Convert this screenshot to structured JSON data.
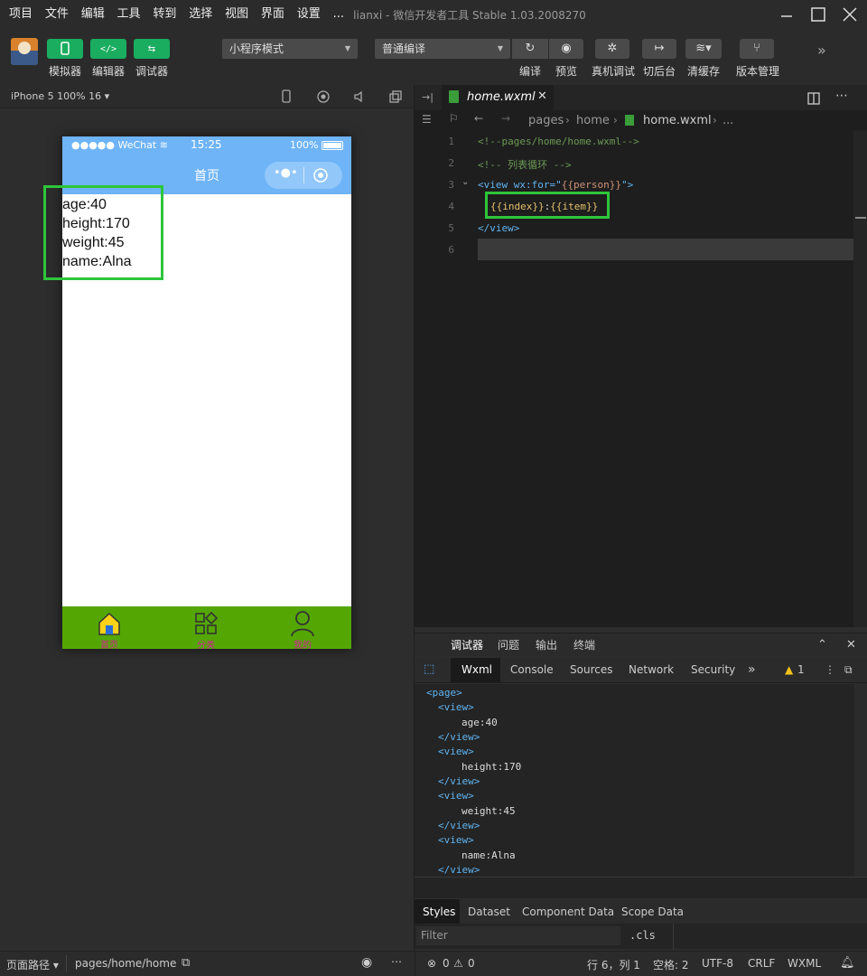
{
  "menu": [
    "项目",
    "文件",
    "编辑",
    "工具",
    "转到",
    "选择",
    "视图",
    "界面",
    "设置",
    "..."
  ],
  "window_title": "lianxi - 微信开发者工具 Stable 1.03.2008270",
  "toolbar": {
    "simulator": "模拟器",
    "editor": "编辑器",
    "debugger": "调试器",
    "mode": "小程序模式",
    "compile_mode": "普通编译",
    "compile": "编译",
    "preview": "预览",
    "remote_debug": "真机调试",
    "background": "切后台",
    "clear_cache": "清缓存",
    "version": "版本管理"
  },
  "simulator": {
    "device": "iPhone 5 100% 16",
    "carrier": "●●●●● WeChat",
    "time": "15:25",
    "battery": "100%",
    "nav_title": "首页",
    "items": [
      "age:40",
      "height:170",
      "weight:45",
      "name:Alna"
    ],
    "tabs": [
      "首页",
      "分类",
      "我的"
    ]
  },
  "editor": {
    "tab": "home.wxml",
    "breadcrumb": [
      "pages",
      "home",
      "home.wxml",
      "..."
    ],
    "lines": [
      {
        "n": "1",
        "text": "<!--pages/home/home.wxml-->"
      },
      {
        "n": "2",
        "text": "<!-- 列表循环 -->"
      },
      {
        "n": "3",
        "open": "<view wx:for=\"",
        "expr": "{{person}}",
        "close": "\">"
      },
      {
        "n": "4",
        "a": "{{index}}",
        "sep": ":",
        "b": "{{item}}"
      },
      {
        "n": "5",
        "text": "</view>"
      },
      {
        "n": "6",
        "text": ""
      }
    ]
  },
  "debug": {
    "tabs": [
      "调试器",
      "问题",
      "输出",
      "终端"
    ],
    "devtabs": [
      "Wxml",
      "Console",
      "Sources",
      "Network",
      "Security"
    ],
    "warn_count": "1",
    "tree": {
      "page_open": "<page>",
      "view_open": "<view>",
      "view_close": "</view>",
      "items": [
        "age:40",
        "height:170",
        "weight:45",
        "name:Alna"
      ]
    },
    "style_tabs": [
      "Styles",
      "Dataset",
      "Component Data",
      "Scope Data"
    ],
    "filter_placeholder": "Filter",
    "cls": ".cls"
  },
  "statusbar": {
    "path_label": "页面路径",
    "path": "pages/home/home",
    "errors": "0",
    "warnings": "0",
    "position": "行 6，列 1",
    "spaces": "空格: 2",
    "encoding": "UTF-8",
    "eol": "CRLF",
    "lang": "WXML"
  }
}
